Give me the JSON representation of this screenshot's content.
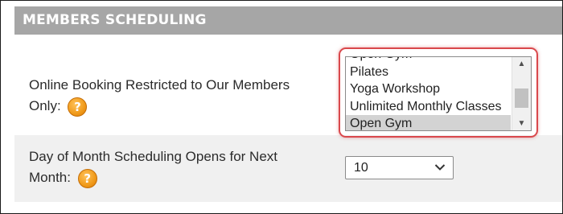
{
  "section": {
    "title": "MEMBERS SCHEDULING"
  },
  "online_booking": {
    "label_line1": "Online Booking Restricted to Our Members",
    "label_line2": "Only:",
    "help_glyph": "?",
    "options": [
      {
        "label": "Open Gym"
      },
      {
        "label": "Pilates"
      },
      {
        "label": "Yoga Workshop"
      },
      {
        "label": "Unlimited Monthly Classes"
      },
      {
        "label": "Open Gym"
      }
    ],
    "selected_option": "Open Gym",
    "scroll_up_glyph": "▲",
    "scroll_down_glyph": "▼"
  },
  "scheduling_opens": {
    "label_line1": "Day of Month Scheduling Opens for Next",
    "label_line2": "Month:",
    "help_glyph": "?",
    "selected_value": "10"
  },
  "colors": {
    "header_bg": "#a6a6a6",
    "row_alt_bg": "#f0f0f0",
    "highlight": "#d9484c",
    "help_icon": "#f09a1a"
  }
}
